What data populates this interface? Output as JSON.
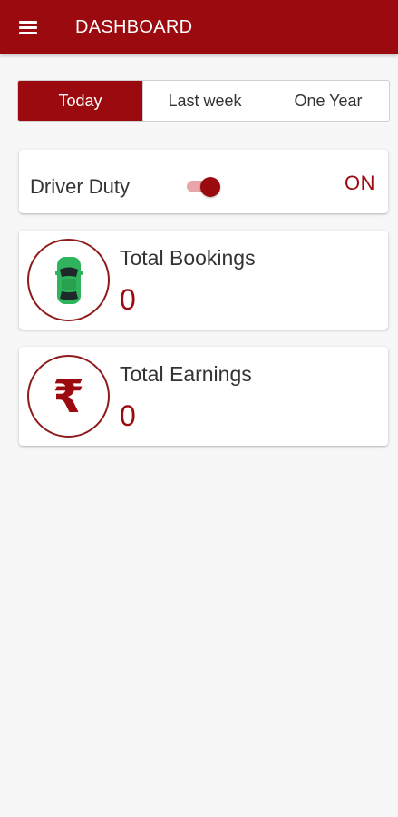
{
  "appbar": {
    "title": "DASHBOARD",
    "menu_icon": "menu-icon"
  },
  "period_tabs": [
    {
      "label": "Today",
      "active": true
    },
    {
      "label": "Last week",
      "active": false
    },
    {
      "label": "One Year",
      "active": false
    }
  ],
  "duty": {
    "label": "Driver Duty",
    "status": "ON",
    "toggle_on": true
  },
  "stats": {
    "bookings": {
      "title": "Total Bookings",
      "value": "0",
      "icon": "car-icon"
    },
    "earnings": {
      "title": "Total Earnings",
      "value": "0",
      "icon": "rupee-icon",
      "symbol": "₹"
    }
  },
  "colors": {
    "primary": "#9b0a0e",
    "car_green": "#2fb35d",
    "background": "#f7f7f7"
  }
}
